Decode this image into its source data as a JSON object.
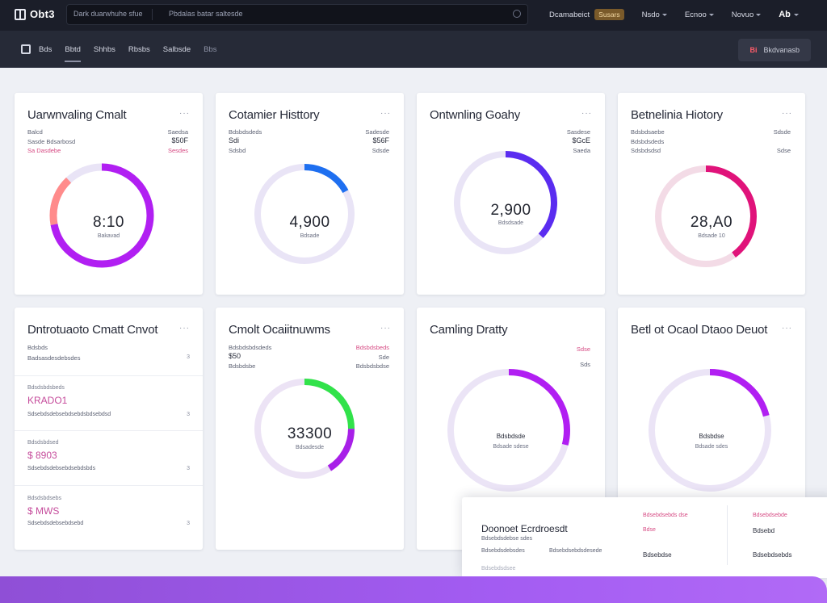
{
  "topbar": {
    "logo": "Obt3",
    "search_primary": "Dark duarwhuhe sfue",
    "search_secondary": "Pbdalas batar saltesde",
    "link": "Dcamabeict",
    "badge": "Susars",
    "menu1": "Nsdo",
    "menu2": "Ecnoo",
    "menu3": "Novuo",
    "avatar": "Ab"
  },
  "subnav": {
    "items": [
      "Bds",
      "Bbtd",
      "Shhbs",
      "Rbsbs",
      "Salbsde",
      "Bbs"
    ],
    "action_icon": "Bi",
    "action_label": "Bkdvanasb"
  },
  "cards": [
    {
      "title": "Uarwnvaling Cmalt",
      "meta_left_1": "Balcd",
      "meta_left_2": "Sasde Bdsarbosd",
      "meta_left_3": "Sa Dasdebe",
      "meta_right_1": "Saedsa",
      "meta_right_2": "$50F",
      "meta_right_3": "Sesdes",
      "value": "8:10",
      "sub": "Bakavad",
      "percent": 0.72,
      "accent": "#b11ff2",
      "accent2": "#ff8b8b"
    },
    {
      "title": "Cotamier Histtory",
      "meta_left_1": "Bdsbdsdeds",
      "meta_left_2": "Sdi",
      "meta_left_3": "Sdsbd",
      "meta_right_1": "Sadesde",
      "meta_right_2": "$56F",
      "meta_right_3": "Sdsde",
      "value": "4,900",
      "sub": "Bdsade",
      "percent": 0.17,
      "accent": "#1e6ff0"
    },
    {
      "title": "Ontwnling Goahy",
      "meta_right_1": "Sasdese",
      "meta_right_2": "$GcE",
      "meta_right_3": "Saeda",
      "value": "2,900",
      "sub": "Bdsdsade",
      "percent": 0.37,
      "accent": "#5a2cf0"
    },
    {
      "title": "Betnelinia Hiotory",
      "meta_left_1": "Bdsbdsaebe",
      "meta_left_2": "Bdsbdsdeds",
      "meta_left_3": "Sdsbdsdsd",
      "meta_right_1": "Sdsde",
      "meta_right_2": "Sdse",
      "value": "28,A0",
      "sub": "Bdsade 10",
      "percent": 0.4,
      "accent": "#e0137a",
      "accent2": "#f7c3d4"
    },
    {
      "title": "Dntrotuaoto Cmatt Cnvot",
      "meta_left_1": "Bdsbds",
      "row1_meta": "Badsasdesdebsdes",
      "rows": [
        {
          "caption": "Bdsdsbdsbeds",
          "value": "KRADO1",
          "meta": "Sdsebdsdebsebdsebdsbdsebdsd",
          "end": "3"
        },
        {
          "caption": "Bdsdsbdsed",
          "value": "$ 8903",
          "meta": "Sdsebdsdebsebdsebdsbds",
          "end": "3"
        },
        {
          "caption": "Bdsdsbdsebs",
          "value": "$ MWS",
          "meta": "Sdsebdsdebsebdsebd",
          "end": "3"
        }
      ]
    },
    {
      "title": "Cmolt Ocaiitnuwms",
      "meta_left_1": "Bdsbdsbdsdeds",
      "meta_left_2": "$50",
      "meta_left_3": "Bdsbdsbe",
      "meta_right_1": "Bdsbdsbeds",
      "meta_right_2": "Sde",
      "meta_right_3": "Bdsbdsbdse",
      "value": "33300",
      "sub": "Bdsadesde",
      "percent": 0.25,
      "accent": "#31e24a",
      "accent2": "#a820e8"
    },
    {
      "title": "Camling Dratty",
      "meta_right_1": "Sdse",
      "meta_right_2": "Sds",
      "value_sub_top": "Bdsbdsde",
      "sub": "Bdsade sdese",
      "percent": 0.29,
      "accent": "#b11ff2"
    },
    {
      "title": "Betl ot Ocaol Dtaoo Deuot",
      "value_sub_top": "Bdsbdse",
      "sub": "Bdsade sdes",
      "percent": 0.21,
      "accent": "#b11ff2"
    }
  ],
  "overlay": {
    "title": "Doonoet Ecrdroesdt",
    "line1": "Bdsebdsdebse sdes",
    "line2": "Bdsebdsdebsdes",
    "line3": "Bdsebdsdsee",
    "line4": "Bdsebdsebdsdesede",
    "col2_1": "Bdsebdsebds dse",
    "col2_2": "Bdse",
    "col2_3": "Bdsebdse",
    "col3_1": "Bdsebdsebde",
    "col3_2": "Bdsebd",
    "col3_3": "Bdsebdsebds"
  }
}
